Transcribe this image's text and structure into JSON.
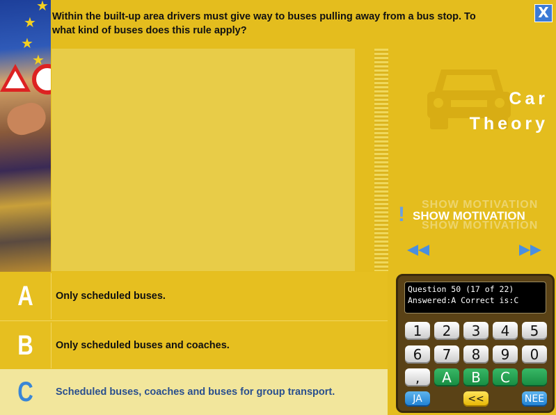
{
  "question": {
    "text": "Within the built-up area drivers must give way to buses pulling away from a bus stop. To what kind of buses does this rule apply?"
  },
  "window": {
    "close_label": "X"
  },
  "side_panel": {
    "title_line1": "Car",
    "title_line2": "Theory",
    "motivation_label": "SHOW MOTIVATION",
    "motivation_ghost": "SHOW MOTIVATION",
    "car_icon": "car-icon",
    "prev_icon": "rewind-icon",
    "next_icon": "fast-forward-icon"
  },
  "answers": [
    {
      "letter": "A",
      "text": "Only scheduled buses."
    },
    {
      "letter": "B",
      "text": "Only scheduled buses and coaches."
    },
    {
      "letter": "C",
      "text": "Scheduled buses, coaches and buses for group transport.",
      "selected": true
    }
  ],
  "console": {
    "line1": "Question 50 (17 of 22)",
    "line2": "Answered:A Correct is:C",
    "keys_row1": [
      "1",
      "2",
      "3",
      "4",
      "5"
    ],
    "keys_row2": [
      "6",
      "7",
      "8",
      "9",
      "0"
    ],
    "comma": ",",
    "answer_keys": [
      "A",
      "B",
      "C",
      ""
    ],
    "yes_label": "JA",
    "back_label": "<<",
    "no_label": "NEE"
  },
  "colors": {
    "background": "#e4bd1e",
    "selected_answer_bg": "#f2e69c",
    "accent_blue": "#3a86d6",
    "console_bg": "#5a4216"
  }
}
